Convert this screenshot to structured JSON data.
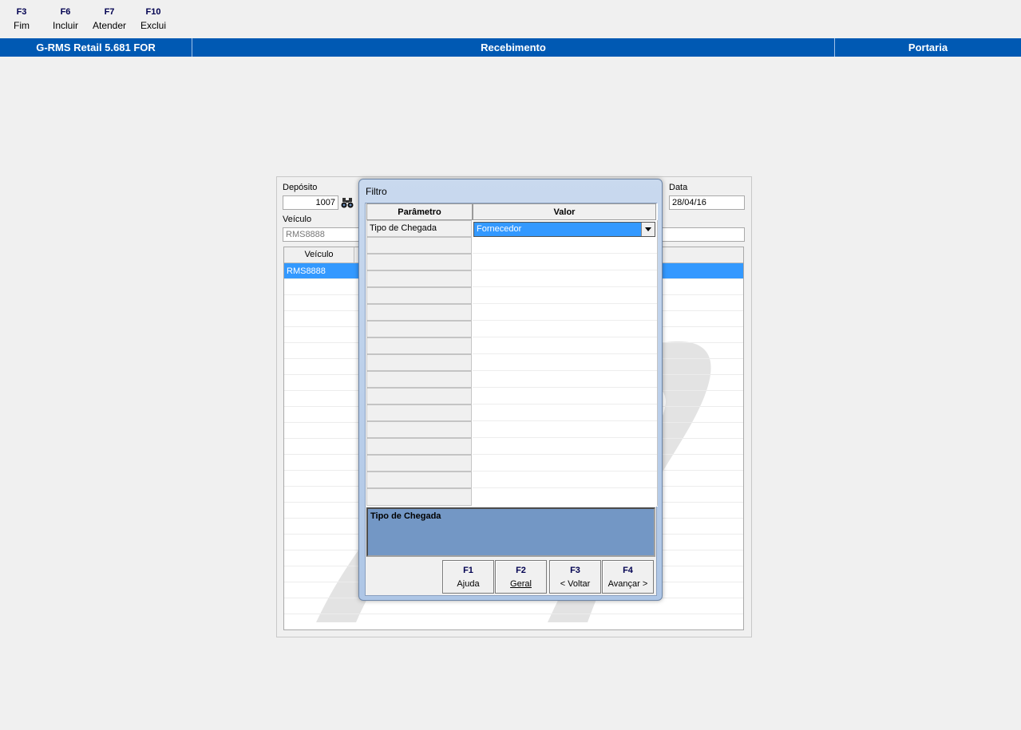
{
  "toolbar": {
    "items": [
      {
        "key": "F3",
        "label": "Fim"
      },
      {
        "key": "F6",
        "label": "Incluir"
      },
      {
        "key": "F7",
        "label": "Atender"
      },
      {
        "key": "F10",
        "label": "Exclui"
      }
    ]
  },
  "titlebar": {
    "app": "G-RMS Retail 5.681 FOR",
    "module": "Recebimento",
    "screen": "Portaria"
  },
  "form": {
    "deposito_label": "Depósito",
    "deposito_value": "1007",
    "data_label": "Data",
    "data_value": "28/04/16",
    "veiculo_label": "Veículo",
    "veiculo_value": "RMS8888",
    "grid": {
      "columns": [
        "Veículo"
      ],
      "rows": [
        [
          "RMS8888"
        ]
      ]
    }
  },
  "icons": {
    "search": "binoculars-icon",
    "dropdown": "chevron-down-icon"
  },
  "dialog": {
    "title": "Filtro",
    "columns": {
      "param": "Parâmetro",
      "value": "Valor"
    },
    "rows": [
      {
        "param": "Tipo de Chegada",
        "value": "Fornecedor"
      }
    ],
    "description": "Tipo de Chegada",
    "buttons": [
      {
        "key": "F1",
        "label": "Ajuda"
      },
      {
        "key": "F2",
        "label": "Geral"
      },
      {
        "key": "F3",
        "label": "< Voltar"
      },
      {
        "key": "F4",
        "label": "Avançar >"
      }
    ]
  },
  "colors": {
    "titlebar": "#0059b3",
    "selection": "#3399ff",
    "description_bg": "#7397c5"
  }
}
